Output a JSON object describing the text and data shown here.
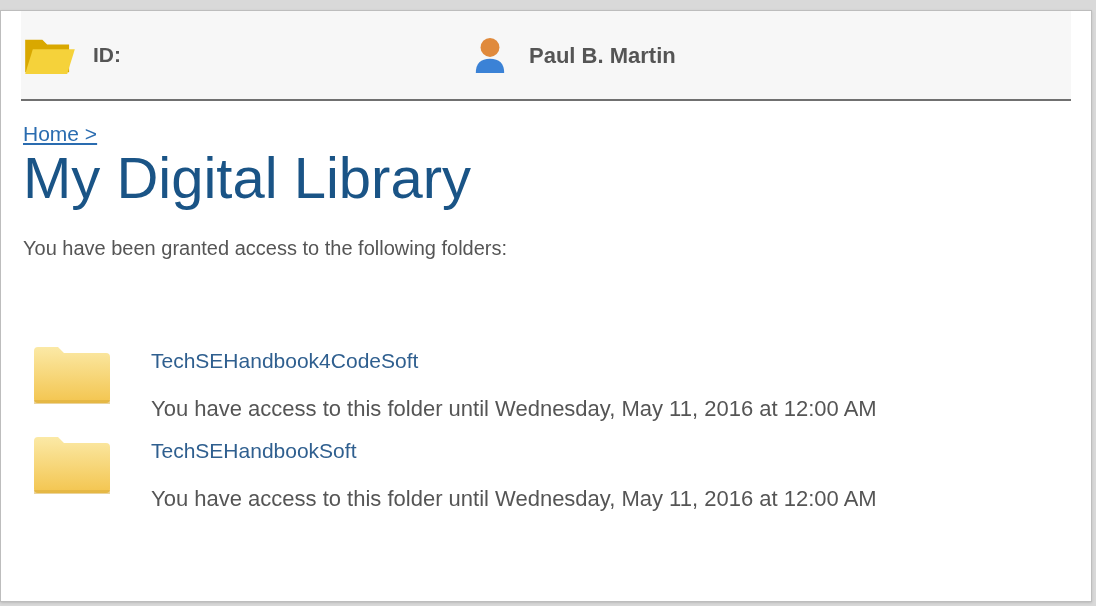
{
  "header": {
    "id_label": "ID:",
    "user_name": "Paul B. Martin"
  },
  "breadcrumb": "Home >",
  "title": "My Digital Library",
  "intro": "You have been granted access to the following folders:",
  "folders": [
    {
      "name": "TechSEHandbook4CodeSoft",
      "access": "You have access to this folder until Wednesday, May 11, 2016 at 12:00 AM"
    },
    {
      "name": "TechSEHandbookSoft",
      "access": "You have access to this folder until Wednesday, May 11, 2016 at 12:00 AM"
    }
  ]
}
